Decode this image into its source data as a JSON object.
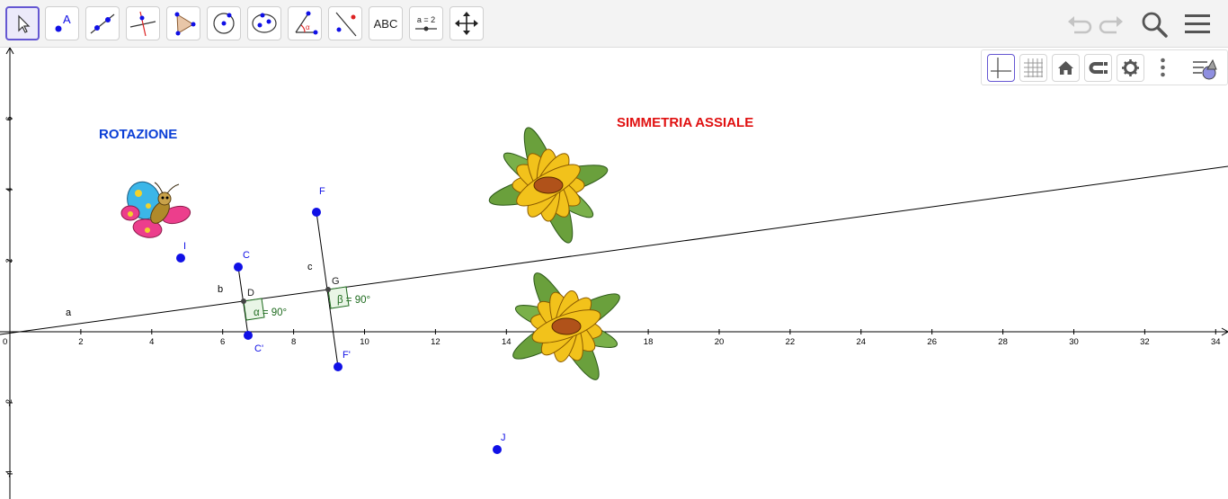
{
  "toolbar": {
    "tools": [
      {
        "name": "move-tool"
      },
      {
        "name": "point-tool",
        "glyph": "A"
      },
      {
        "name": "line-tool"
      },
      {
        "name": "perpendicular-line-tool"
      },
      {
        "name": "polygon-tool"
      },
      {
        "name": "circle-center-point-tool"
      },
      {
        "name": "conic-tool"
      },
      {
        "name": "angle-tool",
        "glyph": "α"
      },
      {
        "name": "reflect-line-tool"
      },
      {
        "name": "text-tool",
        "glyph": "ABC"
      },
      {
        "name": "slider-tool",
        "glyph": "a = 2"
      },
      {
        "name": "move-graphics-view-tool"
      }
    ],
    "right_icons": [
      "undo-icon",
      "redo-icon",
      "search-icon",
      "menu-icon"
    ]
  },
  "style_bar": {
    "buttons": [
      "axes-toggle",
      "grid-toggle",
      "home-view",
      "point-capturing",
      "settings",
      "more-options",
      "toggle-style-bar"
    ]
  },
  "canvas": {
    "rotation_title": "ROTAZIONE",
    "symmetry_title": "SIMMETRIA ASSIALE",
    "colors": {
      "point": "#1010e6",
      "rotation_title": "#0b3fd6",
      "symmetry_title": "#e01010",
      "angle": "#1e6b1e",
      "line": "#000000"
    },
    "x_ticks": [
      "0",
      "2",
      "4",
      "6",
      "8",
      "10",
      "12",
      "14",
      "16",
      "18",
      "20",
      "22",
      "24",
      "26",
      "28",
      "30",
      "32",
      "34"
    ],
    "y_ticks": [
      "6",
      "4",
      "2",
      "-2",
      "-4"
    ],
    "points": [
      {
        "label": "I"
      },
      {
        "label": "C"
      },
      {
        "label": "C'"
      },
      {
        "label": "F"
      },
      {
        "label": "F'"
      },
      {
        "label": "J"
      },
      {
        "label": "D"
      },
      {
        "label": "G"
      }
    ],
    "line_labels": {
      "a": "a",
      "b": "b",
      "c": "c"
    },
    "angles": {
      "alpha": "α = 90°",
      "beta": "β = 90°"
    }
  }
}
